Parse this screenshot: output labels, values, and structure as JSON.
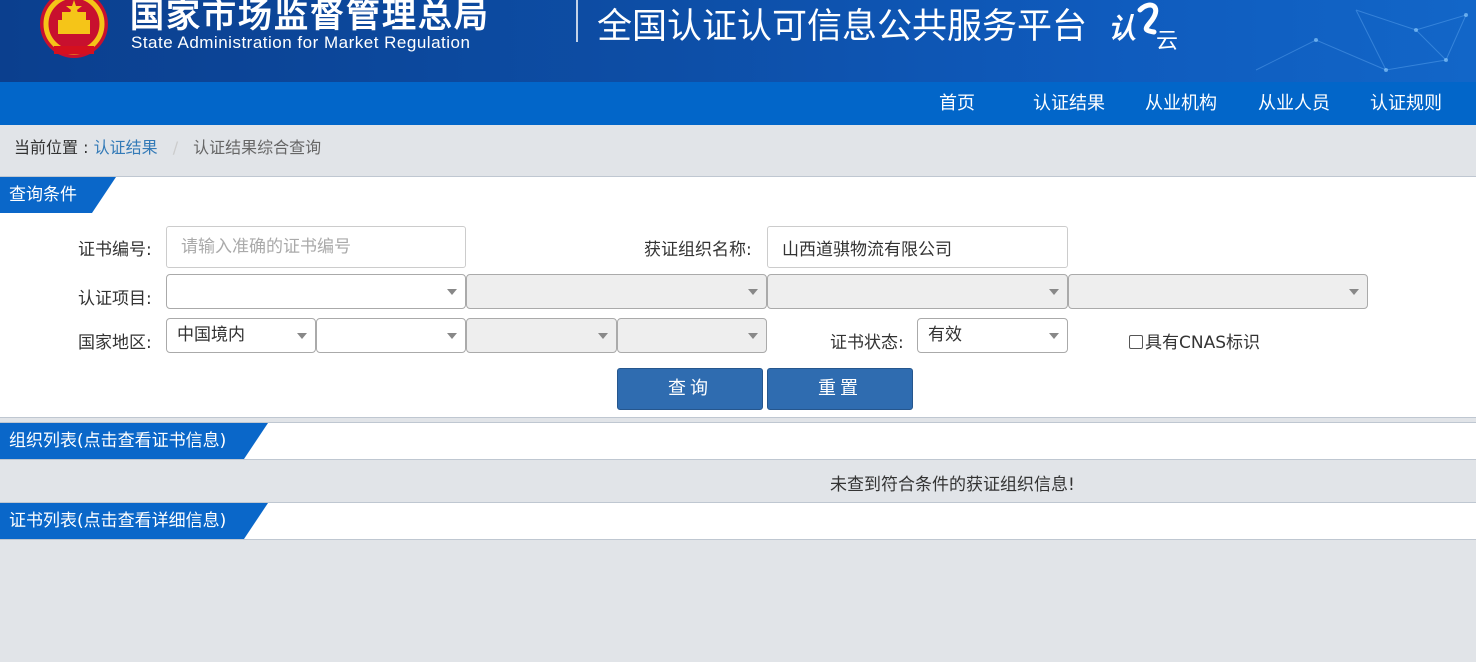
{
  "header": {
    "agency_cn": "国家市场监督管理总局",
    "agency_en": "State Administration  for  Market Regulation",
    "platform_title": "全国认证认可信息公共服务平台",
    "brand_colors": {
      "header": "#0d4ea6",
      "nav": "#0266c9",
      "button": "#2f6cb0"
    },
    "emblem_icon": "national-emblem-icon",
    "logo_icon": "renyun-logo-icon"
  },
  "nav": {
    "items": [
      {
        "label": "首页"
      },
      {
        "label": "认证结果"
      },
      {
        "label": "从业机构"
      },
      {
        "label": "从业人员"
      },
      {
        "label": "认证规则"
      }
    ]
  },
  "breadcrumb": {
    "prefix": "当前位置 :",
    "link": "认证结果",
    "separator": "/",
    "current": "认证结果综合查询"
  },
  "query": {
    "section_title": "查询条件",
    "cert_no_label": "证书编号:",
    "cert_no_placeholder": "请输入准确的证书编号",
    "cert_no_value": "",
    "org_name_label": "获证组织名称:",
    "org_name_value": "山西道骐物流有限公司",
    "project_label": "认证项目:",
    "project_selects": [
      "",
      "",
      "",
      ""
    ],
    "region_label": "国家地区:",
    "region_selects": [
      "中国境内",
      "",
      "",
      ""
    ],
    "status_label": "证书状态:",
    "status_value": "有效",
    "cnas_label": "具有CNAS标识",
    "search_button": "查询",
    "reset_button": "重置"
  },
  "org_list": {
    "section_title": "组织列表(点击查看证书信息)",
    "empty_message": "未查到符合条件的获证组织信息!"
  },
  "cert_list": {
    "section_title": "证书列表(点击查看详细信息)"
  }
}
